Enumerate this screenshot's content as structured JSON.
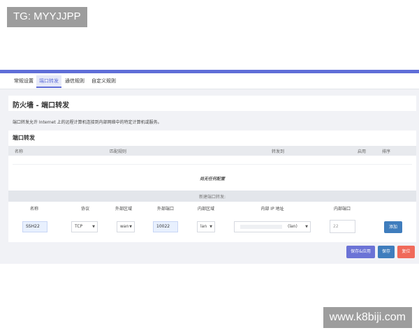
{
  "watermarks": {
    "top_left": "TG: MYYJJPP",
    "bottom_right": "www.k8biji.com"
  },
  "tabs": [
    {
      "label": "常规设置",
      "active": false
    },
    {
      "label": "端口转发",
      "active": true
    },
    {
      "label": "通信规则",
      "active": false
    },
    {
      "label": "自定义规则",
      "active": false
    }
  ],
  "page_title": "防火墙 - 端口转发",
  "description": "端口转发允许 Internet 上的远程计算机连接到内部网络中的特定计算机或服务。",
  "section": {
    "title": "端口转发",
    "columns": [
      "名称",
      "匹配规则",
      "转发到",
      "启用",
      "排序"
    ],
    "empty_text": "尚无任何配置"
  },
  "new_forward": {
    "header": "新建端口转发:",
    "columns": [
      "名称",
      "协议",
      "外部区域",
      "外部端口",
      "内部区域",
      "内部 IP 地址",
      "内部端口"
    ],
    "values": {
      "name": "SSH22",
      "protocol": "TCP",
      "external_zone": "wan",
      "external_port": "10022",
      "internal_zone": "lan",
      "internal_ip_suffix": "(lan)",
      "internal_port_placeholder": "22"
    },
    "add_label": "添加"
  },
  "footer": {
    "save_apply": "保存&应用",
    "save": "保存",
    "reset": "复位"
  },
  "colors": {
    "accent": "#5f6ed8",
    "button_blue": "#3f7dbd",
    "button_reset": "#f06a5a"
  }
}
